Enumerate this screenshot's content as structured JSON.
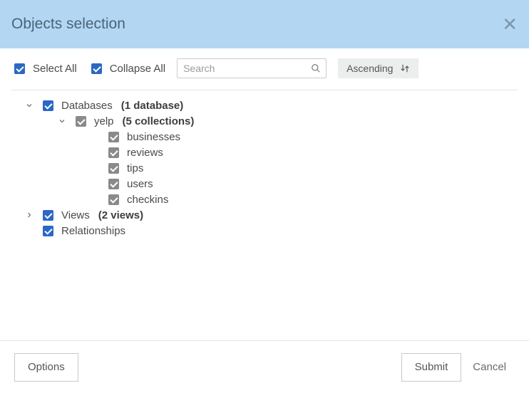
{
  "header": {
    "title": "Objects selection"
  },
  "toolbar": {
    "select_all": "Select All",
    "collapse_all": "Collapse All",
    "search_placeholder": "Search",
    "sort_label": "Ascending"
  },
  "tree": {
    "databases": {
      "label": "Databases",
      "count_text": "(1 database)",
      "expanded": true,
      "children": [
        {
          "label": "yelp",
          "count_text": "(5 collections)",
          "expanded": true,
          "children": [
            {
              "label": "businesses"
            },
            {
              "label": "reviews"
            },
            {
              "label": "tips"
            },
            {
              "label": "users"
            },
            {
              "label": "checkins"
            }
          ]
        }
      ]
    },
    "views": {
      "label": "Views",
      "count_text": "(2 views)",
      "expanded": false
    },
    "relationships": {
      "label": "Relationships"
    }
  },
  "footer": {
    "options": "Options",
    "submit": "Submit",
    "cancel": "Cancel"
  }
}
